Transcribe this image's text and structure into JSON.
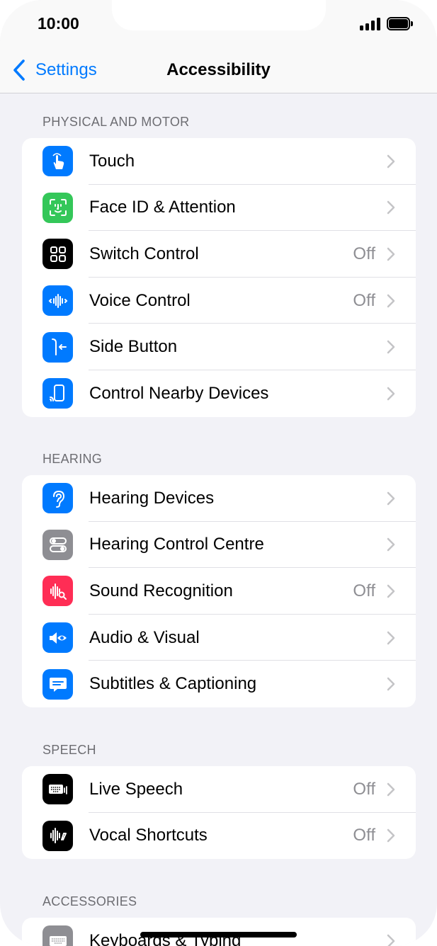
{
  "status": {
    "time": "10:00"
  },
  "nav": {
    "back_label": "Settings",
    "title": "Accessibility"
  },
  "sections": [
    {
      "header": "PHYSICAL AND MOTOR",
      "items": [
        {
          "label": "Touch",
          "value": "",
          "icon": "hand-tap-icon",
          "color": "#007aff"
        },
        {
          "label": "Face ID & Attention",
          "value": "",
          "icon": "face-id-icon",
          "color": "#34c759"
        },
        {
          "label": "Switch Control",
          "value": "Off",
          "icon": "switch-control-icon",
          "color": "#000000"
        },
        {
          "label": "Voice Control",
          "value": "Off",
          "icon": "voice-control-icon",
          "color": "#007aff"
        },
        {
          "label": "Side Button",
          "value": "",
          "icon": "side-button-icon",
          "color": "#007aff"
        },
        {
          "label": "Control Nearby Devices",
          "value": "",
          "icon": "nearby-devices-icon",
          "color": "#007aff"
        }
      ]
    },
    {
      "header": "HEARING",
      "items": [
        {
          "label": "Hearing Devices",
          "value": "",
          "icon": "ear-icon",
          "color": "#007aff"
        },
        {
          "label": "Hearing Control Centre",
          "value": "",
          "icon": "toggles-icon",
          "color": "#8e8e93"
        },
        {
          "label": "Sound Recognition",
          "value": "Off",
          "icon": "sound-recognition-icon",
          "color": "#ff2d55"
        },
        {
          "label": "Audio & Visual",
          "value": "",
          "icon": "audio-visual-icon",
          "color": "#007aff"
        },
        {
          "label": "Subtitles & Captioning",
          "value": "",
          "icon": "captions-icon",
          "color": "#007aff"
        }
      ]
    },
    {
      "header": "SPEECH",
      "items": [
        {
          "label": "Live Speech",
          "value": "Off",
          "icon": "keyboard-speech-icon",
          "color": "#000000"
        },
        {
          "label": "Vocal Shortcuts",
          "value": "Off",
          "icon": "vocal-shortcuts-icon",
          "color": "#000000"
        }
      ]
    },
    {
      "header": "ACCESSORIES",
      "items": [
        {
          "label": "Keyboards & Typing",
          "value": "",
          "icon": "keyboard-icon",
          "color": "#8e8e93"
        }
      ]
    }
  ]
}
